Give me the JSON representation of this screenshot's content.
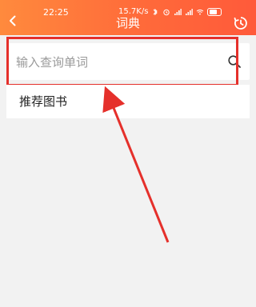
{
  "status_bar": {
    "time": "22:25",
    "net_speed": "15.7K/s",
    "icons": [
      "bluetooth-icon",
      "alarm-icon",
      "signal-icon",
      "signal-icon-2",
      "wifi-icon",
      "battery-icon"
    ]
  },
  "header": {
    "title": "词典",
    "back_icon": "chevron-left-icon",
    "history_icon": "history-icon"
  },
  "search": {
    "placeholder": "输入查询单词",
    "icon": "search-icon"
  },
  "list": {
    "recommend_label": "推荐图书"
  },
  "colors": {
    "header_start": "#ff8a3d",
    "header_end": "#ff5a3a",
    "highlight_red": "#e5302b"
  }
}
